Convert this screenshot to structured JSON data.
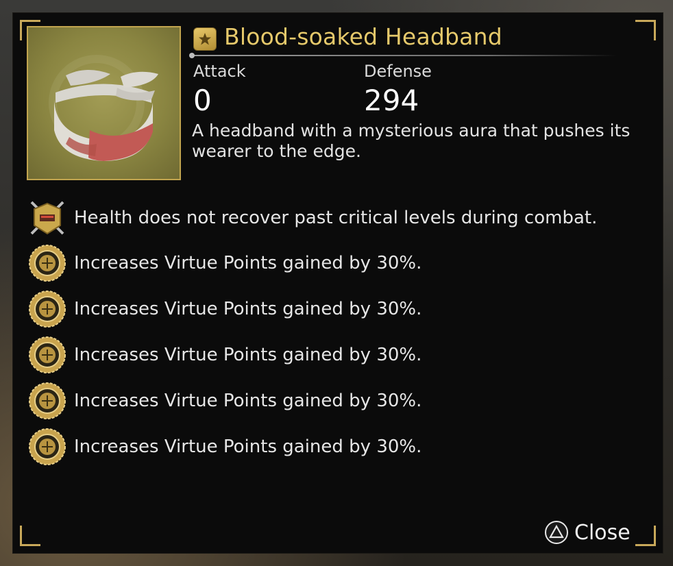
{
  "item": {
    "name": "Blood-soaked Headband",
    "icon": "blood-soaked-headband",
    "rarity_icon": "gold-rarity-star-icon",
    "stats": {
      "attack_label": "Attack",
      "attack_value": "0",
      "defense_label": "Defense",
      "defense_value": "294"
    },
    "description": "A headband with a mysterious aura that pushes its wearer to the edge."
  },
  "effects": [
    {
      "icon": "crossed-swords-shield-icon",
      "text": "Health does not recover past critical levels during combat."
    },
    {
      "icon": "virtue-medal-icon",
      "text": "Increases Virtue Points gained by 30%."
    },
    {
      "icon": "virtue-medal-icon",
      "text": "Increases Virtue Points gained by 30%."
    },
    {
      "icon": "virtue-medal-icon",
      "text": "Increases Virtue Points gained by 30%."
    },
    {
      "icon": "virtue-medal-icon",
      "text": "Increases Virtue Points gained by 30%."
    },
    {
      "icon": "virtue-medal-icon",
      "text": "Increases Virtue Points gained by 30%."
    }
  ],
  "footer": {
    "close_button_icon": "triangle-button-icon",
    "close_label": "Close"
  },
  "colors": {
    "panel_bg": "#0b0b0b",
    "gold_accent": "#e6c96b",
    "frame_gold": "#c2a54f",
    "text": "#e6e6e6"
  }
}
